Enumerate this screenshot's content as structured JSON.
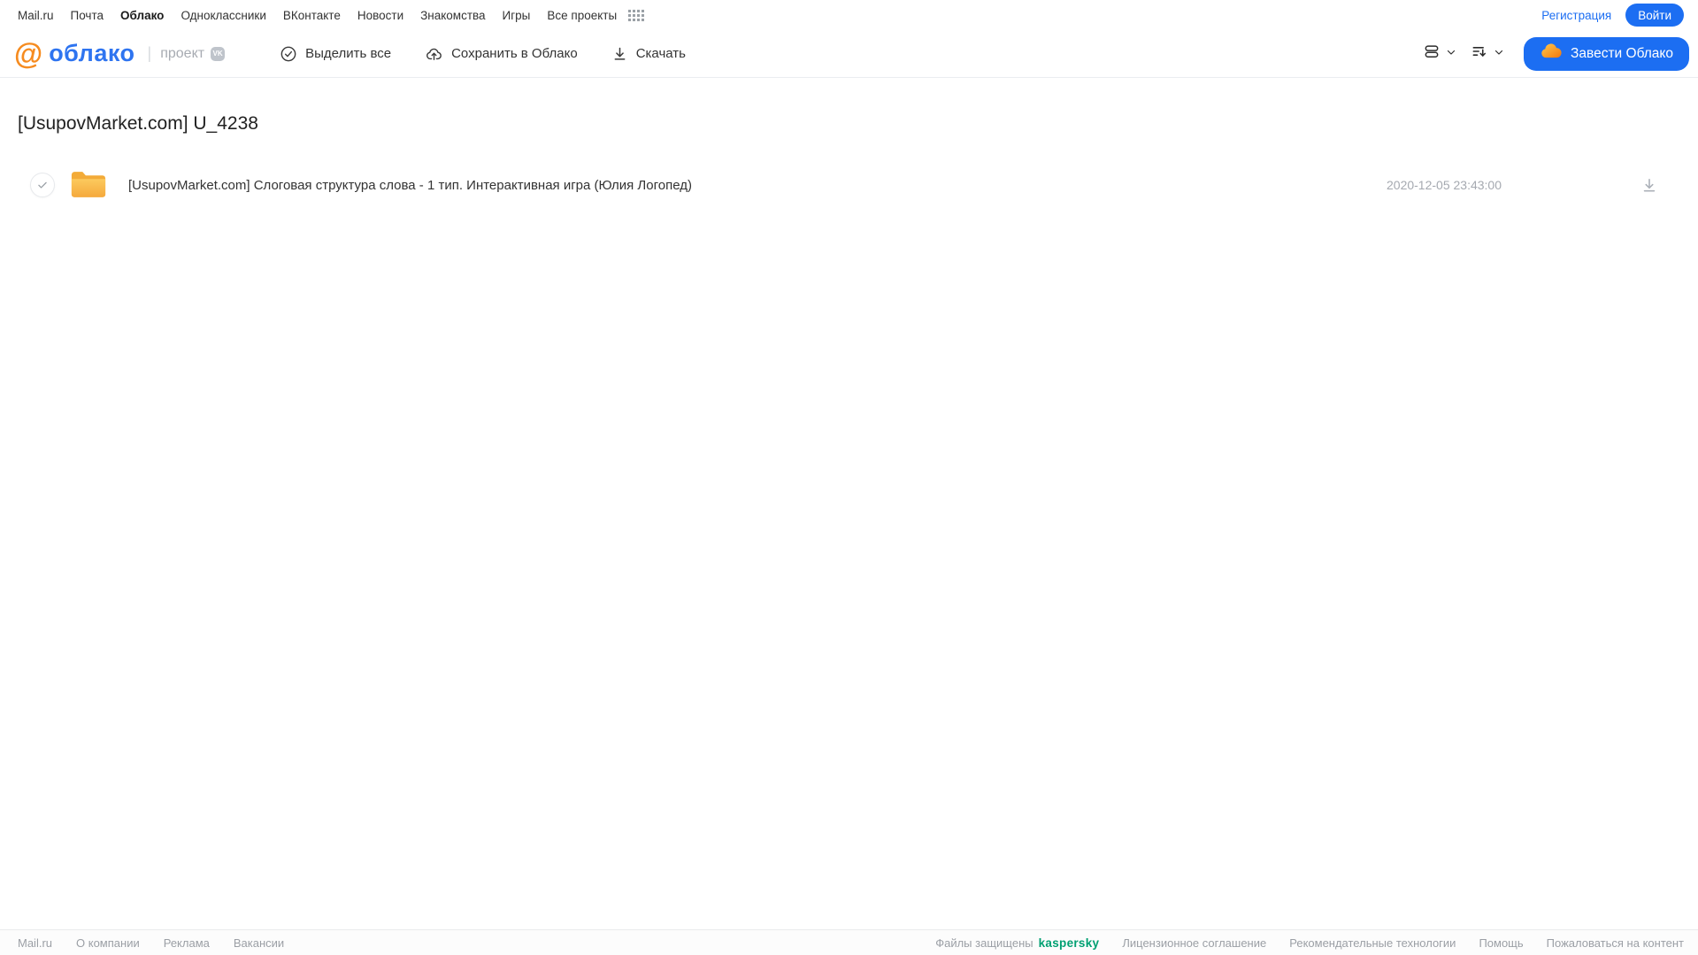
{
  "portal_nav": {
    "items": [
      "Mail.ru",
      "Почта",
      "Облако",
      "Одноклассники",
      "ВКонтакте",
      "Новости",
      "Знакомства",
      "Игры",
      "Все проекты"
    ],
    "active_item": "Облако",
    "registration": "Регистрация",
    "login": "Войти"
  },
  "brand": {
    "at_symbol": "@",
    "logo_text": "облако",
    "separator": "|",
    "subtitle": "проект",
    "vk_badge": "VK"
  },
  "toolbar": {
    "select_all": "Выделить все",
    "save_to_cloud": "Сохранить в Облако",
    "download": "Скачать",
    "cta": "Завести Облако"
  },
  "page": {
    "title": "[UsupovMarket.com] U_4238"
  },
  "file": {
    "name": "[UsupovMarket.com] Слоговая структура слова - 1 тип. Интерактивная игра (Юлия Логопед)",
    "modified": "2020-12-05 23:43:00"
  },
  "footer": {
    "left_links": [
      "Mail.ru",
      "О компании",
      "Реклама",
      "Вакансии"
    ],
    "protected_label": "Файлы защищены",
    "kaspersky": "kaspersky",
    "right_links": [
      "Лицензионное соглашение",
      "Рекомендательные технологии",
      "Помощь",
      "Пожаловаться на контент"
    ]
  },
  "colors": {
    "accent_blue": "#1c6ef2",
    "logo_blue": "#2e74f0",
    "logo_orange": "#f68b1f",
    "folder_yellow_top": "#fcca5e",
    "folder_yellow_bottom": "#f5a93c",
    "kaspersky_green": "#00a072",
    "muted_gray": "#a5a9b0"
  }
}
